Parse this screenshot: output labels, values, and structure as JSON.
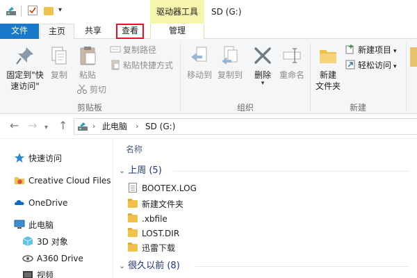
{
  "window": {
    "title": "SD (G:)",
    "context_tab_header": "驱动器工具"
  },
  "tabs": {
    "file": "文件",
    "home": "主页",
    "share": "共享",
    "view": "查看",
    "manage": "管理"
  },
  "ribbon": {
    "clipboard": {
      "group_label": "剪贴板",
      "pin": "固定到\"快",
      "pin_line2": "速访问\"",
      "copy": "复制",
      "paste": "粘贴",
      "copy_path": "复制路径",
      "paste_shortcut": "粘贴快捷方式",
      "cut": "剪切"
    },
    "organize": {
      "group_label": "组织",
      "move_to": "移动到",
      "copy_to": "复制到",
      "delete": "删除",
      "rename": "重命名"
    },
    "new": {
      "group_label": "新建",
      "new_folder": "新建",
      "new_folder_line2": "文件夹",
      "new_item": "新建项目",
      "easy_access": "轻松访问"
    }
  },
  "address": {
    "crumbs": [
      "此电脑",
      "SD (G:)"
    ]
  },
  "nav_pane": {
    "items": [
      {
        "label": "快速访问",
        "icon": "star-icon"
      },
      {
        "label": "Creative Cloud Files",
        "icon": "creative-cloud-icon"
      },
      {
        "label": "OneDrive",
        "icon": "cloud-icon"
      },
      {
        "label": "此电脑",
        "icon": "computer-icon"
      },
      {
        "label": "3D 对象",
        "icon": "cube-icon"
      },
      {
        "label": "A360 Drive",
        "icon": "a360-icon"
      },
      {
        "label": "视频",
        "icon": "video-icon"
      }
    ]
  },
  "file_list": {
    "column_name": "名称",
    "groups": [
      {
        "title": "上周 (5)",
        "items": [
          {
            "name": "BOOTEX.LOG",
            "icon": "document-icon"
          },
          {
            "name": "新建文件夹",
            "icon": "folder-icon"
          },
          {
            "name": ".xbfile",
            "icon": "folder-icon"
          },
          {
            "name": "LOST.DIR",
            "icon": "folder-icon"
          },
          {
            "name": "迅雷下载",
            "icon": "folder-icon"
          }
        ]
      },
      {
        "title": "很久以前 (8)",
        "items": []
      }
    ]
  },
  "colors": {
    "file_tab": "#1979ca",
    "context_header": "#f7f4ad",
    "group_header_text": "#1e3287",
    "highlight_border": "#e81123",
    "folder": "#f0c14b"
  }
}
